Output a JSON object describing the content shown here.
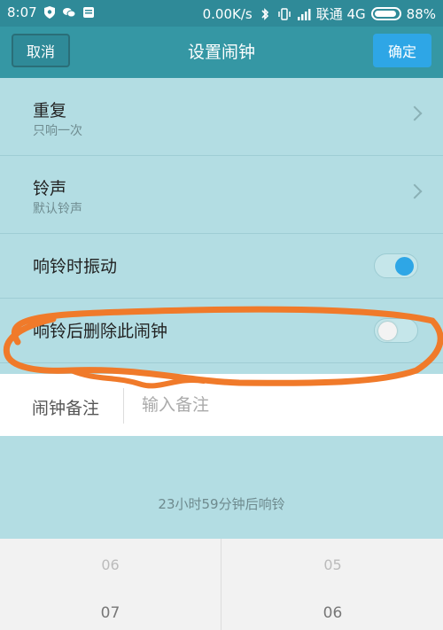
{
  "status_bar": {
    "time": "8:07",
    "network_speed": "0.00K/s",
    "carrier": "联通 4G",
    "battery": "88%",
    "icons": [
      "shield-icon",
      "wechat-icon",
      "message-icon",
      "bluetooth-icon",
      "vibrate-icon",
      "signal-icon",
      "battery-icon"
    ]
  },
  "nav": {
    "cancel_label": "取消",
    "title": "设置闹钟",
    "ok_label": "确定"
  },
  "settings": {
    "repeat": {
      "title": "重复",
      "value": "只响一次"
    },
    "ringtone": {
      "title": "铃声",
      "value": "默认铃声"
    },
    "vibrate": {
      "title": "响铃时振动",
      "enabled": true
    },
    "delete_after": {
      "title": "响铃后删除此闹钟",
      "enabled": false
    }
  },
  "note": {
    "label": "闹钟备注",
    "placeholder": "输入备注",
    "value": ""
  },
  "countdown": "23小时59分钟后响铃",
  "picker": {
    "hours": [
      "06",
      "07"
    ],
    "minutes": [
      "05",
      "06"
    ]
  },
  "colors": {
    "accent": "#2ea6e6",
    "header": "#3597a4",
    "annotation": "#f07a2a"
  }
}
